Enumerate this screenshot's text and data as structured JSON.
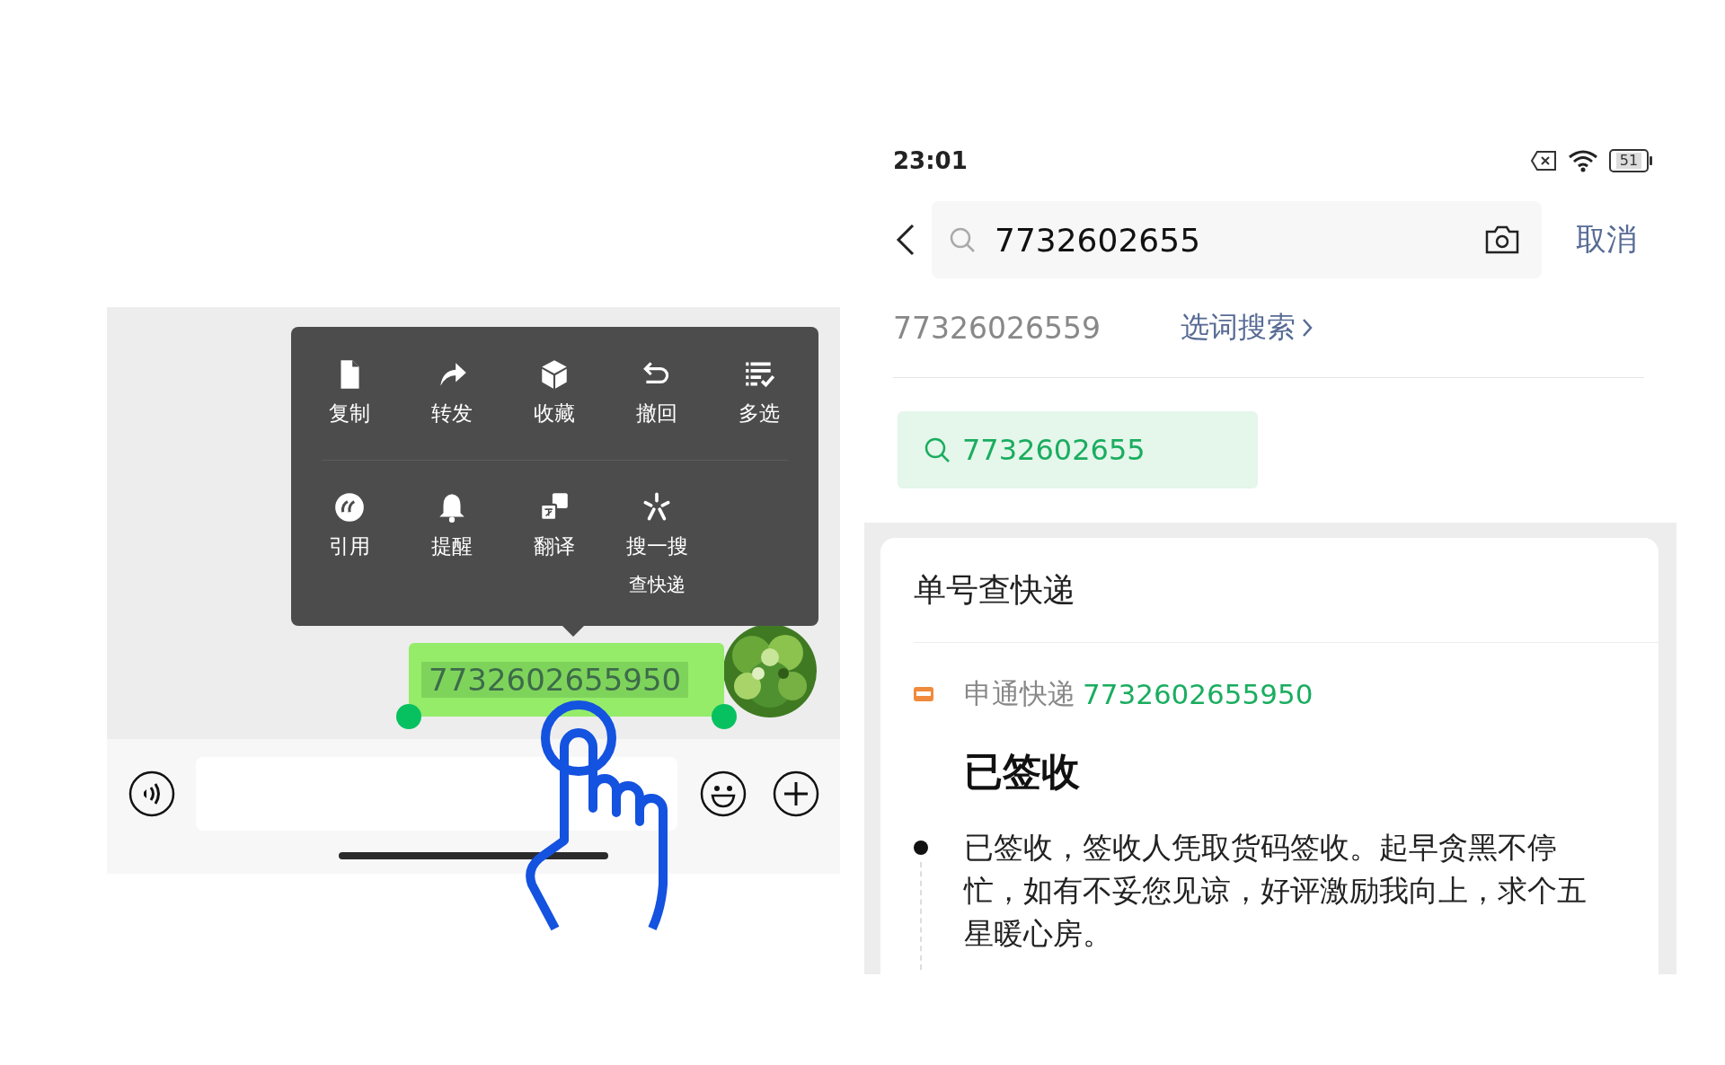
{
  "chat": {
    "menu": {
      "items": [
        {
          "label": "复制",
          "kind": "copy"
        },
        {
          "label": "转发",
          "kind": "forward"
        },
        {
          "label": "收藏",
          "kind": "favorite"
        },
        {
          "label": "撤回",
          "kind": "recall"
        },
        {
          "label": "多选",
          "kind": "multiselect"
        },
        {
          "label": "引用",
          "kind": "quote"
        },
        {
          "label": "提醒",
          "kind": "remind"
        },
        {
          "label": "翻译",
          "kind": "translate"
        },
        {
          "label": "搜一搜",
          "sublabel": "查快递",
          "kind": "search"
        }
      ]
    },
    "message": {
      "text": "7732602655950",
      "selected": true
    }
  },
  "search_screen": {
    "status_bar": {
      "time": "23:01",
      "battery": "51"
    },
    "search": {
      "value": "7732602655",
      "cancel": "取消"
    },
    "suggestion": {
      "text": "77326026559",
      "action": "选词搜索"
    },
    "search_chip": {
      "text": "7732602655"
    },
    "card": {
      "title": "单号查快递",
      "carrier": "申通快递",
      "tracking_number": "7732602655950",
      "status": "已签收",
      "events": [
        {
          "text": "已签收，签收人凭取货码签收。起早贪黑不停忙，如有不妥您见谅，好评激励我向上，求个五星暖心房。"
        }
      ]
    }
  }
}
